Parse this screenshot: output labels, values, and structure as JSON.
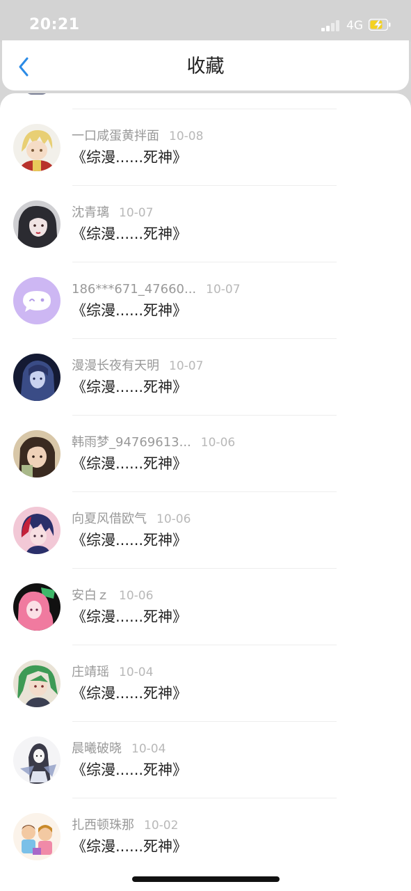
{
  "status_bar": {
    "time": "20:21",
    "network": "4G",
    "signal_icon": "cellular-signal-icon",
    "battery_icon": "battery-charging-icon"
  },
  "header": {
    "title": "收藏",
    "back_icon": "chevron-left-icon",
    "accent_color": "#2b8be6"
  },
  "favorites": [
    {
      "user": "一口咸蛋黄拌面",
      "date": "10-08",
      "book": "《综漫......死神》",
      "avatar_icon": "anime-avatar-blonde-icon"
    },
    {
      "user": "沈青璃",
      "date": "10-07",
      "book": "《综漫......死神》",
      "avatar_icon": "anime-avatar-dark-hair-icon"
    },
    {
      "user": "186***671_47660...",
      "date": "10-07",
      "book": "《综漫......死神》",
      "avatar_icon": "default-chat-bubble-avatar-icon"
    },
    {
      "user": "漫漫长夜有天明",
      "date": "10-07",
      "book": "《综漫......死神》",
      "avatar_icon": "anime-avatar-night-icon"
    },
    {
      "user": "韩雨梦_94769613...",
      "date": "10-06",
      "book": "《综漫......死神》",
      "avatar_icon": "photo-avatar-girl-icon"
    },
    {
      "user": "向夏风借欧气",
      "date": "10-06",
      "book": "《综漫......死神》",
      "avatar_icon": "anime-avatar-redblue-icon"
    },
    {
      "user": "安白ｚ",
      "date": "10-06",
      "book": "《综漫......死神》",
      "avatar_icon": "anime-avatar-pink-hair-icon"
    },
    {
      "user": "庄靖瑶",
      "date": "10-04",
      "book": "《综漫......死神》",
      "avatar_icon": "anime-avatar-green-hair-icon"
    },
    {
      "user": "晨曦破晓",
      "date": "10-04",
      "book": "《综漫......死神》",
      "avatar_icon": "sketch-avatar-icon"
    },
    {
      "user": "扎西顿珠那",
      "date": "10-02",
      "book": "《综漫......死神》",
      "avatar_icon": "cartoon-kids-avatar-icon"
    }
  ]
}
